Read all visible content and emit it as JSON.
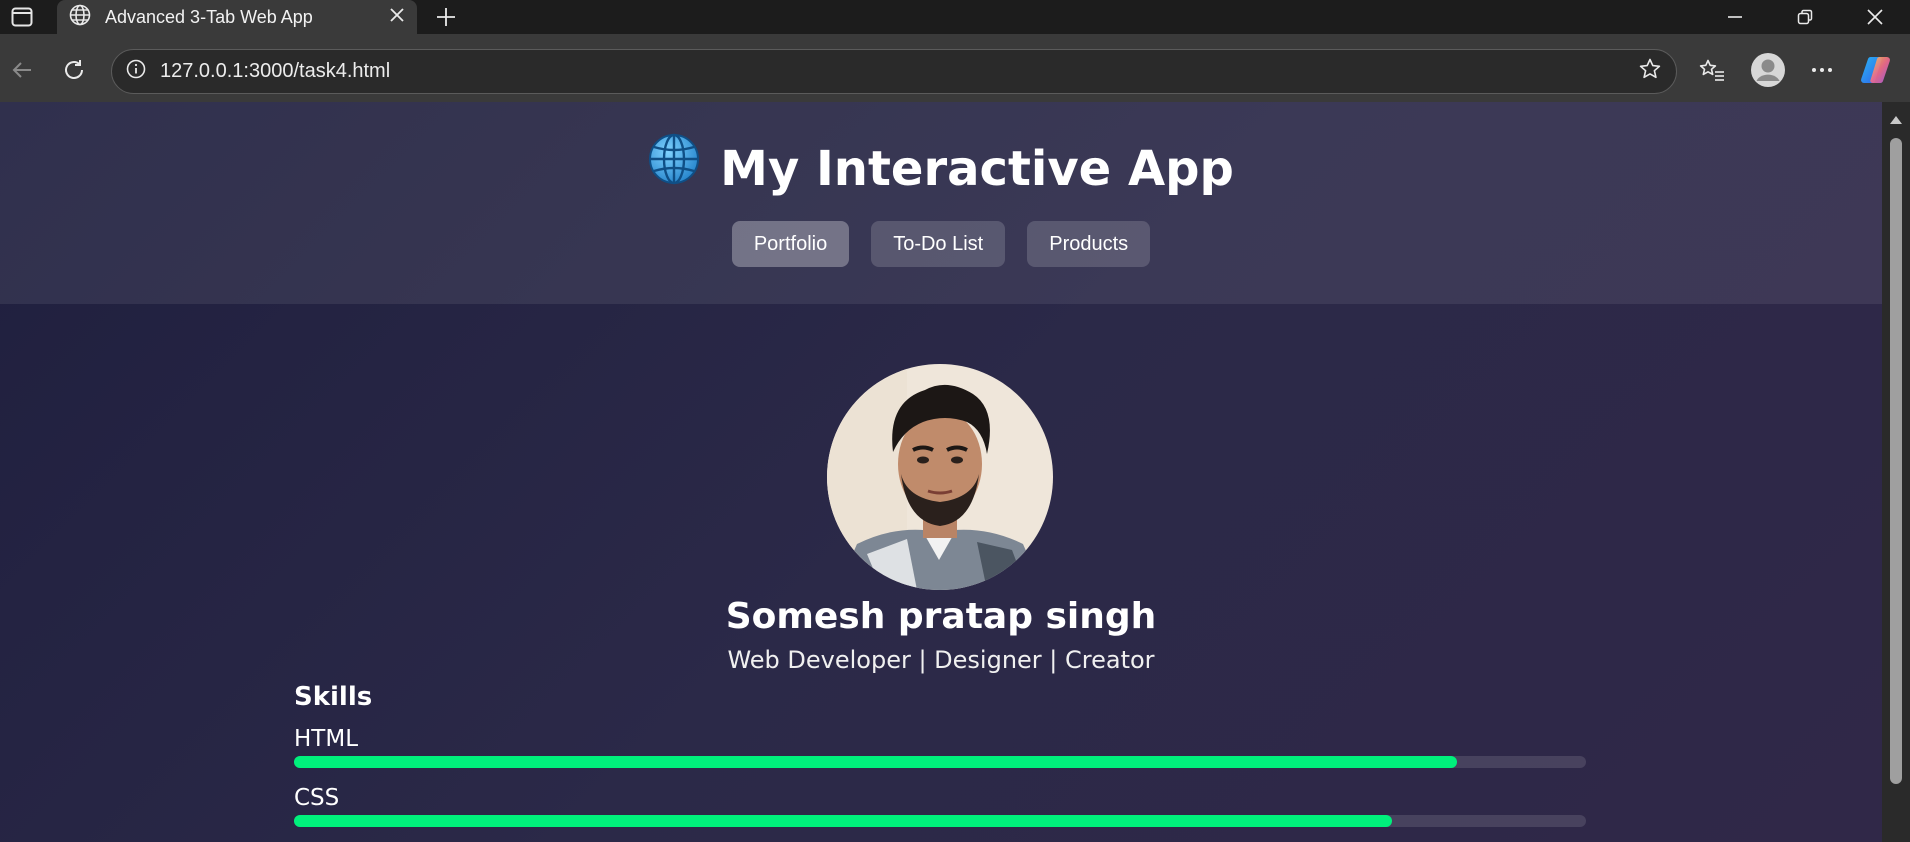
{
  "browser": {
    "tab_title": "Advanced 3-Tab Web App",
    "url": "127.0.0.1:3000/task4.html"
  },
  "app": {
    "title": "My Interactive App",
    "tabs": [
      {
        "label": "Portfolio",
        "active": true
      },
      {
        "label": "To-Do List",
        "active": false
      },
      {
        "label": "Products",
        "active": false
      }
    ]
  },
  "profile": {
    "name": "Somesh pratap singh",
    "role": "Web Developer | Designer | Creator"
  },
  "skills": {
    "title": "Skills",
    "items": [
      {
        "label": "HTML",
        "level": 0.9
      },
      {
        "label": "CSS",
        "level": 0.85
      }
    ]
  },
  "colors": {
    "skill_bar": "#00f07c",
    "accent_globe": "#3ea8e8"
  },
  "icons": [
    "tab-actions-icon",
    "globe-icon",
    "close-icon",
    "plus-icon",
    "minimize-icon",
    "restore-icon",
    "back-icon",
    "reload-icon",
    "info-icon",
    "star-icon",
    "favorites-icon",
    "profile-icon",
    "more-icon",
    "copilot-icon"
  ]
}
